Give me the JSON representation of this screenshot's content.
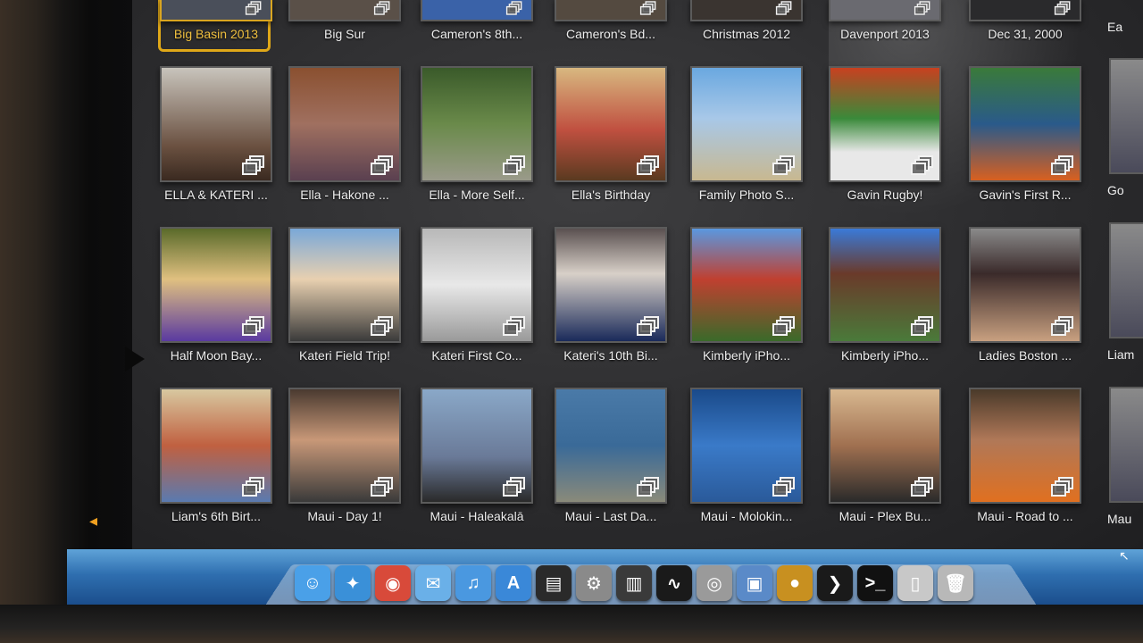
{
  "albums_top": [
    {
      "title": "Big Basin 2013",
      "selected": true,
      "bg": "#4a4f5a"
    },
    {
      "title": "Big Sur",
      "bg": "#5a5048"
    },
    {
      "title": "Cameron's 8th...",
      "bg": "#3a62a8"
    },
    {
      "title": "Cameron's Bd...",
      "bg": "#544a40"
    },
    {
      "title": "Christmas 2012",
      "bg": "#3a3430"
    },
    {
      "title": "Davenport 2013",
      "bg": "#6a6a70"
    },
    {
      "title": "Dec 31, 2000",
      "bg": "#2a2a2c"
    }
  ],
  "albums_row1": [
    {
      "title": "ELLA & KATERI ...",
      "bg": "linear-gradient(180deg,#c8c4bc,#6a5040 70%,#3a2a20)"
    },
    {
      "title": "Ella - Hakone ...",
      "bg": "linear-gradient(180deg,#8a5030,#a07060 50%,#5a4050)"
    },
    {
      "title": "Ella - More Self...",
      "bg": "linear-gradient(180deg,#3a5a2a,#6a8a4a 50%,#9a9a8a)"
    },
    {
      "title": "Ella's Birthday",
      "bg": "linear-gradient(180deg,#d8b880,#c05040 55%,#5a3a20)"
    },
    {
      "title": "Family Photo S...",
      "bg": "linear-gradient(180deg,#6aa8e0,#a8c8e8 45%,#c8b890)"
    },
    {
      "title": "Gavin Rugby!",
      "bg": "linear-gradient(180deg,#c84020,#3a8a3a 45%,#e8e8e8 75%)"
    },
    {
      "title": "Gavin's First R...",
      "bg": "linear-gradient(180deg,#3a7a3a,#2a5a8a 50%,#d86020)"
    }
  ],
  "albums_row2": [
    {
      "title": "Half Moon Bay...",
      "bg": "linear-gradient(180deg,#5a6a2a,#e0c080 45%,#5a3aa0)"
    },
    {
      "title": "Kateri Field Trip!",
      "bg": "linear-gradient(180deg,#7aa8d8,#e8d0b0 45%,#3a3a3a)"
    },
    {
      "title": "Kateri First Co...",
      "bg": "linear-gradient(180deg,#b8b8b8,#e8e8e8 50%,#9a9a9a)"
    },
    {
      "title": "Kateri's 10th Bi...",
      "bg": "linear-gradient(180deg,#5a5050,#d8d0c8 40%,#1a2a5a)"
    },
    {
      "title": "Kimberly iPho...",
      "bg": "linear-gradient(180deg,#5a98e0,#c04030 45%,#3a6a2a)"
    },
    {
      "title": "Kimberly iPho...",
      "bg": "linear-gradient(180deg,#3a7ad8,#6a3a2a 40%,#4a7a3a)"
    },
    {
      "title": "Ladies Boston ...",
      "bg": "linear-gradient(180deg,#8a8a8a,#3a2a2a 40%,#c8a080)"
    }
  ],
  "albums_row3": [
    {
      "title": "Liam's 6th Birt...",
      "bg": "linear-gradient(180deg,#d8c8a0,#c06040 50%,#5a7ab0)"
    },
    {
      "title": "Maui - Day 1!",
      "bg": "linear-gradient(180deg,#4a3a30,#c89878 45%,#3a3a3a)"
    },
    {
      "title": "Maui - Haleakalā",
      "bg": "linear-gradient(180deg,#8aa8c8,#6a7a98 60%,#2a2a2a)"
    },
    {
      "title": "Maui - Last Da...",
      "bg": "linear-gradient(180deg,#4a7aa8,#3a6a98 50%,#8a8a7a)"
    },
    {
      "title": "Maui - Molokin...",
      "bg": "linear-gradient(180deg,#1a4a8a,#3a7ac8 50%,#2a5a9a)"
    },
    {
      "title": "Maui - Plex Bu...",
      "bg": "linear-gradient(180deg,#d8b890,#a07050 50%,#2a2a2a)"
    },
    {
      "title": "Maui - Road to ...",
      "bg": "linear-gradient(180deg,#4a3a2a,#b07858 45%,#e07020)"
    }
  ],
  "edge_labels": [
    "Ea",
    "Go",
    "Liam",
    "Mau"
  ],
  "dock": [
    {
      "name": "finder-icon",
      "glyph": "☺",
      "color": "#4aa0e8"
    },
    {
      "name": "safari-icon",
      "glyph": "✦",
      "color": "#3a90d8"
    },
    {
      "name": "chrome-icon",
      "glyph": "◉",
      "color": "#d84a3a"
    },
    {
      "name": "messages-icon",
      "glyph": "✉",
      "color": "#6ab0e8"
    },
    {
      "name": "itunes-icon",
      "glyph": "♫",
      "color": "#4a98e0"
    },
    {
      "name": "app-store-icon",
      "glyph": "A",
      "color": "#3a88d8"
    },
    {
      "name": "console-icon",
      "glyph": "▤",
      "color": "#2a2a2a"
    },
    {
      "name": "system-preferences-icon",
      "glyph": "⚙",
      "color": "#8a8a8a"
    },
    {
      "name": "keyboard-icon",
      "glyph": "▥",
      "color": "#3a3a3a"
    },
    {
      "name": "activity-monitor-icon",
      "glyph": "∿",
      "color": "#1a1a1a"
    },
    {
      "name": "disk-utility-icon",
      "glyph": "◎",
      "color": "#9a9a9a"
    },
    {
      "name": "preview-icon",
      "glyph": "▣",
      "color": "#5a8ac8"
    },
    {
      "name": "plex-icon",
      "glyph": "●",
      "color": "#c89020"
    },
    {
      "name": "plex-media-icon",
      "glyph": "❯",
      "color": "#1a1a1a"
    },
    {
      "name": "terminal-icon",
      "glyph": ">_",
      "color": "#111111"
    },
    {
      "name": "documents-stack-icon",
      "glyph": "▯",
      "color": "#c8c8c8"
    },
    {
      "name": "trash-icon",
      "glyph": "🗑",
      "color": "#b8b8b8"
    }
  ]
}
